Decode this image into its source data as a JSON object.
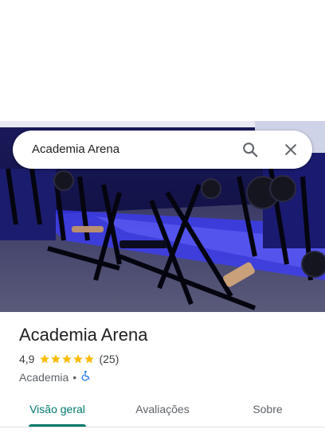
{
  "search": {
    "query": "Academia Arena"
  },
  "place": {
    "name": "Academia Arena",
    "rating": "4,9",
    "stars": 5,
    "review_count": "(25)",
    "category": "Academia",
    "separator": "•"
  },
  "tabs": [
    {
      "label": "Visão geral",
      "active": true
    },
    {
      "label": "Avaliações",
      "active": false
    },
    {
      "label": "Sobre",
      "active": false
    }
  ],
  "colors": {
    "accent": "#00796b",
    "star": "#fbbc04",
    "accessibility": "#1a73e8"
  },
  "icons": {
    "search": "search-icon",
    "close": "close-icon",
    "accessible": "wheelchair-icon",
    "star": "star-icon"
  }
}
